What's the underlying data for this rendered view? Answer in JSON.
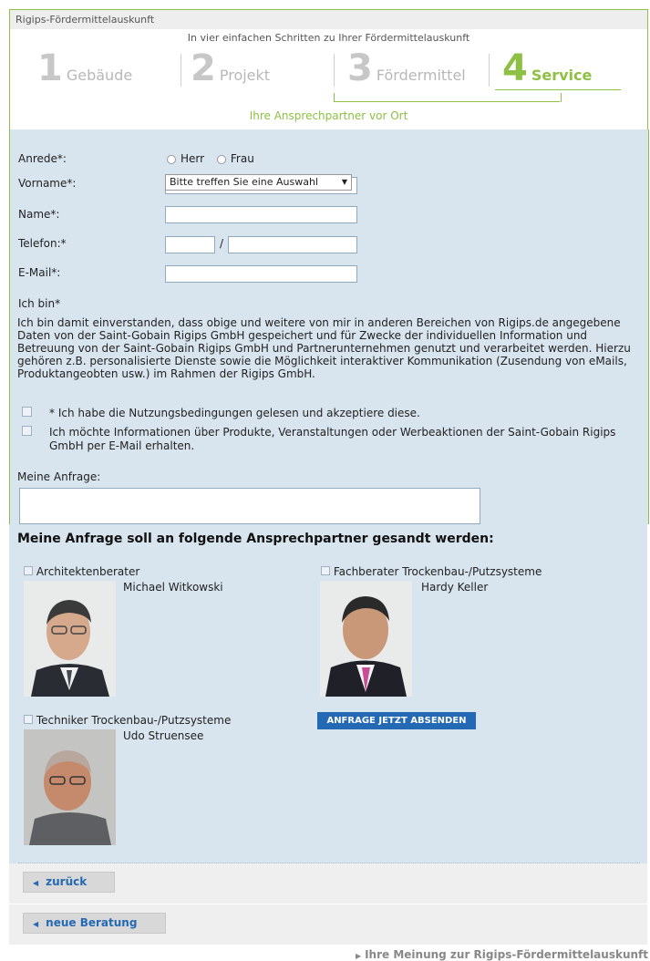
{
  "window": {
    "title": "Rigips-Fördermittelauskunft"
  },
  "header": {
    "subtitle": "In vier einfachen Schritten zu Ihrer Fördermittelauskunft",
    "steps": [
      {
        "num": "1",
        "label": "Gebäude"
      },
      {
        "num": "2",
        "label": "Projekt"
      },
      {
        "num": "3",
        "label": "Fördermittel"
      },
      {
        "num": "4",
        "label": "Service"
      }
    ],
    "active_step": 4,
    "step_description": "Ihre Ansprechpartner vor Ort",
    "accent_color": "#8dc044"
  },
  "form": {
    "anrede_label": "Anrede*:",
    "anrede_options": [
      "Herr",
      "Frau"
    ],
    "vorname_label": "Vorname*:",
    "vorname_value": "",
    "name_label": "Name*:",
    "name_value": "",
    "telefon_label": "Telefon:*",
    "telefon_separator": "/",
    "email_label": "E-Mail*:",
    "email_value": "",
    "ichbin_label": "Ich bin*",
    "ichbin_selected": "Bitte treffen Sie eine Auswahl",
    "consent_text": "Ich bin damit einverstanden, dass obige und weitere von mir in anderen Bereichen von Rigips.de angegebene Daten von der Saint-Gobain Rigips GmbH gespeichert und für Zwecke der individuellen Information und Betreuung von der Saint-Gobain Rigips GmbH und Partnerunternehmen genutzt und verarbeitet werden. Hierzu gehören z.B. personalisierte Dienste sowie die Möglichkeit interaktiver Kommunikation (Zusendung von eMails, Produktangeobten usw.) im Rahmen der Rigips GmbH.",
    "checkbox_terms": "* Ich habe die Nutzungsbedingungen gelesen und akzeptiere diese.",
    "checkbox_newsletter": "Ich möchte Informationen über Produkte, Veranstaltungen oder Werbeaktionen der Saint-Gobain Rigips GmbH per E-Mail erhalten.",
    "anfrage_label": "Meine Anfrage:"
  },
  "contacts": {
    "section_title": "Meine Anfrage soll an folgende Ansprechpartner gesandt werden:",
    "items": [
      {
        "role": "Architektenberater",
        "name": "Michael Witkowski"
      },
      {
        "role": "Fachberater Trockenbau-/Putzsysteme",
        "name": "Hardy Keller"
      },
      {
        "role": "Techniker Trockenbau-/Putzsysteme",
        "name": "Udo Struensee"
      }
    ],
    "send_button": "ANFRAGE JETZT ABSENDEN",
    "button_color": "#2469b4"
  },
  "nav": {
    "back_label": "zurück",
    "new_label": "neue Beratung",
    "feedback_link": "Ihre Meinung zur Rigips-Fördermittelauskunft"
  }
}
